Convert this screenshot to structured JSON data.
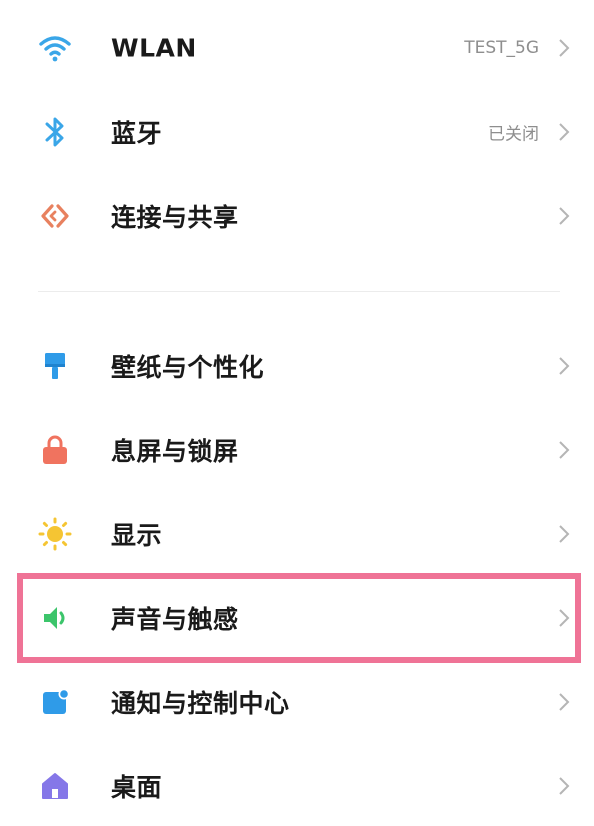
{
  "items": [
    {
      "label": "WLAN",
      "value": "TEST_5G",
      "icon": "wifi-icon",
      "color": "#3aa6e8"
    },
    {
      "label": "蓝牙",
      "value": "已关闭",
      "icon": "bluetooth-icon",
      "color": "#3aa6e8"
    },
    {
      "label": "连接与共享",
      "value": "",
      "icon": "connection-sharing-icon",
      "color": "#e8815f"
    },
    {
      "label": "壁纸与个性化",
      "value": "",
      "icon": "paint-brush-icon",
      "color": "#2f9be8"
    },
    {
      "label": "息屏与锁屏",
      "value": "",
      "icon": "lock-icon",
      "color": "#f0735f"
    },
    {
      "label": "显示",
      "value": "",
      "icon": "brightness-icon",
      "color": "#f5c533"
    },
    {
      "label": "声音与触感",
      "value": "",
      "icon": "speaker-icon",
      "color": "#3cc56b"
    },
    {
      "label": "通知与控制中心",
      "value": "",
      "icon": "notification-icon",
      "color": "#2f9be8"
    },
    {
      "label": "桌面",
      "value": "",
      "icon": "home-icon",
      "color": "#8577e8"
    }
  ],
  "highlight_color": "#ef7396"
}
